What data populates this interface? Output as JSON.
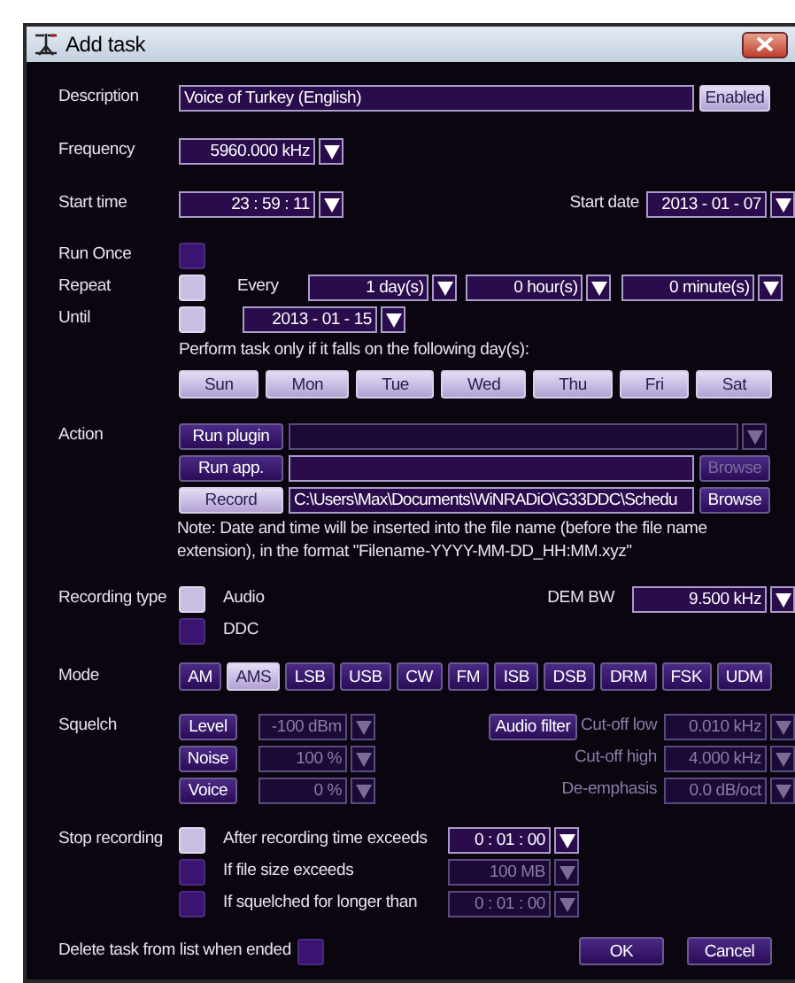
{
  "window": {
    "title": "Add task"
  },
  "description": {
    "label": "Description",
    "value": "Voice of Turkey (English)",
    "toggle": "Enabled"
  },
  "frequency": {
    "label": "Frequency",
    "value": "5960.000 kHz"
  },
  "start_time": {
    "label": "Start time",
    "value": "23 : 59 : 11"
  },
  "start_date": {
    "label": "Start date",
    "value": "2013 - 01 - 07"
  },
  "schedule": [
    {
      "label": "Run Once",
      "checked": false
    },
    {
      "label": "Repeat",
      "checked": true
    },
    {
      "label": "Until",
      "checked": true
    }
  ],
  "every": {
    "label": "Every",
    "fields": [
      "1 day(s)",
      "0 hour(s)",
      "0 minute(s)"
    ]
  },
  "until_date": "2013 - 01 - 15",
  "days_hint": "Perform task only if it falls on the following day(s):",
  "days": [
    {
      "label": "Sun",
      "selected": true
    },
    {
      "label": "Mon",
      "selected": true
    },
    {
      "label": "Tue",
      "selected": true
    },
    {
      "label": "Wed",
      "selected": true
    },
    {
      "label": "Thu",
      "selected": true
    },
    {
      "label": "Fri",
      "selected": true
    },
    {
      "label": "Sat",
      "selected": true
    }
  ],
  "action": {
    "label": "Action",
    "options": [
      {
        "label": "Run plugin",
        "selected": false,
        "kind": "dropdown",
        "disabled": true
      },
      {
        "label": "Run app.",
        "selected": false,
        "kind": "browse",
        "browse": "Browse",
        "disabled": true
      },
      {
        "label": "Record",
        "selected": true,
        "kind": "browse",
        "value": "C:\\Users\\Max\\Documents\\WiNRADiO\\G33DDC\\Schedu",
        "browse": "Browse",
        "disabled": false
      }
    ]
  },
  "note": "Note: Date and time will be inserted into the file name (before the file name extension), in the format \"Filename-YYYY-MM-DD_HH:MM.xyz\"",
  "recording_type": {
    "label": "Recording type",
    "options": [
      {
        "label": "Audio",
        "checked": true
      },
      {
        "label": "DDC",
        "checked": false
      }
    ]
  },
  "dem_bw": {
    "label": "DEM BW",
    "value": "9.500 kHz"
  },
  "mode": {
    "label": "Mode",
    "options": [
      {
        "label": "AM",
        "selected": false
      },
      {
        "label": "AMS",
        "selected": true
      },
      {
        "label": "LSB",
        "selected": false
      },
      {
        "label": "USB",
        "selected": false
      },
      {
        "label": "CW",
        "selected": false
      },
      {
        "label": "FM",
        "selected": false
      },
      {
        "label": "ISB",
        "selected": false
      },
      {
        "label": "DSB",
        "selected": false
      },
      {
        "label": "DRM",
        "selected": false
      },
      {
        "label": "FSK",
        "selected": false
      },
      {
        "label": "UDM",
        "selected": false
      }
    ]
  },
  "squelch": {
    "label": "Squelch",
    "rows": [
      {
        "button": "Level",
        "value": "-100 dBm",
        "disabled": true
      },
      {
        "button": "Noise",
        "value": "100 %",
        "disabled": true
      },
      {
        "button": "Voice",
        "value": "0 %",
        "disabled": true
      }
    ]
  },
  "audio_filter": {
    "button": "Audio filter",
    "rows": [
      {
        "label": "Cut-off low",
        "value": "0.010 kHz",
        "disabled": true
      },
      {
        "label": "Cut-off high",
        "value": "4.000 kHz",
        "disabled": true
      },
      {
        "label": "De-emphasis",
        "value": "0.0 dB/oct",
        "disabled": true
      }
    ]
  },
  "stop_recording": {
    "label": "Stop recording",
    "rows": [
      {
        "label": "After recording time exceeds",
        "checked": true,
        "value": "0 : 01 : 00",
        "disabled": false
      },
      {
        "label": "If file size exceeds",
        "checked": false,
        "value": "100 MB",
        "disabled": true
      },
      {
        "label": "If squelched for longer than",
        "checked": false,
        "value": "0 : 01 : 00",
        "disabled": true
      }
    ]
  },
  "delete_when_ended": {
    "label": "Delete task from list when ended",
    "checked": false
  },
  "buttons": [
    {
      "label": "OK"
    },
    {
      "label": "Cancel"
    }
  ]
}
